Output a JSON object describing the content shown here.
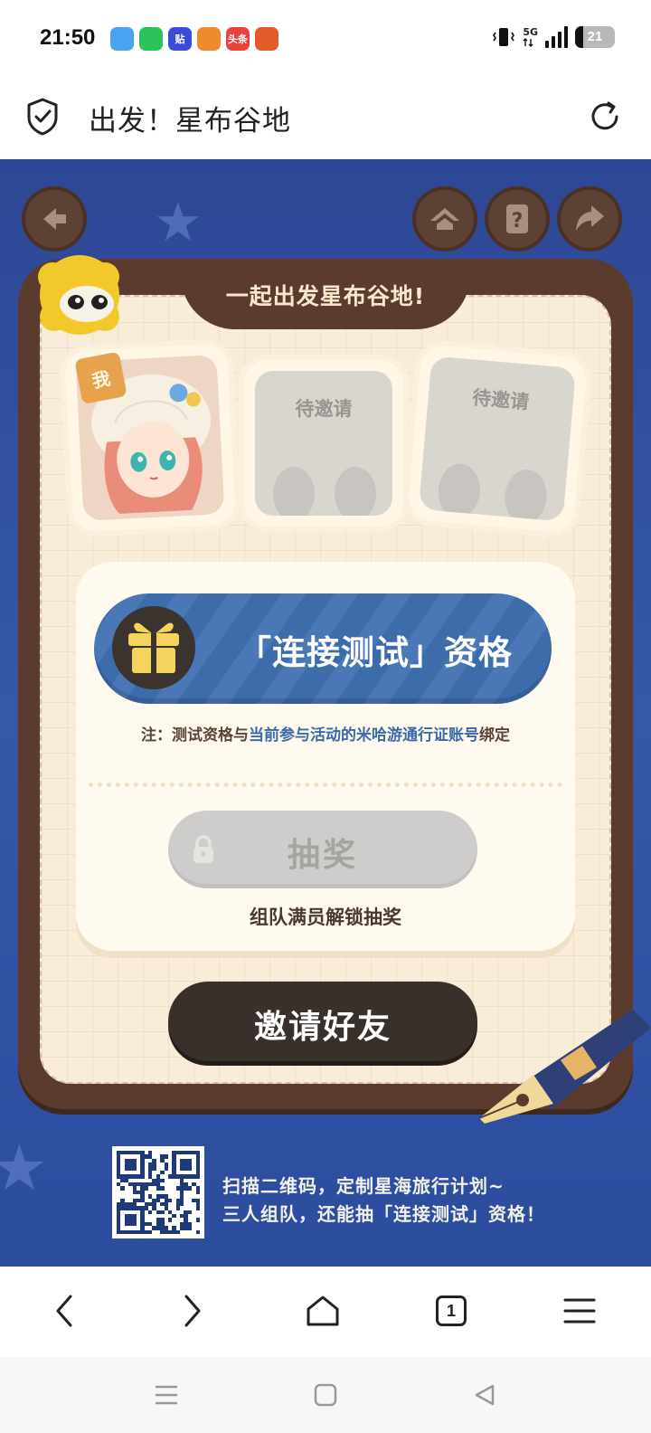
{
  "status_bar": {
    "time": "21:50",
    "network": "5G",
    "battery": "21",
    "battery_level": 0.21,
    "notification_icons": [
      {
        "name": "weather-app-icon",
        "color": "#4aa3f0",
        "text": ""
      },
      {
        "name": "wechat-app-icon",
        "color": "#2bc25a",
        "text": ""
      },
      {
        "name": "tieba-app-icon",
        "color": "#3b4bd6",
        "text": "贴"
      },
      {
        "name": "video-app-icon",
        "color": "#f08a2e",
        "text": ""
      },
      {
        "name": "toutiao-app-icon",
        "color": "#e8423a",
        "text": "头条"
      },
      {
        "name": "game-app-icon",
        "color": "#e35b2a",
        "text": ""
      }
    ]
  },
  "browser": {
    "page_title": "出发！星布谷地",
    "tab_count": "1"
  },
  "game": {
    "banner_title": "一起出发星布谷地!",
    "me_badge": "我",
    "pending_slots": [
      "待邀请",
      "待邀请"
    ],
    "qualification_label": "「连接测试」资格",
    "note_prefix": "注：测试资格与",
    "note_highlight": "当前参与活动的米哈游通行证账号",
    "note_suffix": "绑定",
    "draw_label": "抽奖",
    "draw_locked": true,
    "unlock_note": "组队满员解锁抽奖",
    "invite_label": "邀请好友",
    "promo_line1": "扫描二维码，定制星海旅行计划~",
    "promo_line2": "三人组队，还能抽「连接测试」资格！"
  },
  "colors": {
    "background_blue": "#3558a8",
    "frame_brown": "#5a3b2d",
    "paper": "#f9ecd8",
    "qualification_blue": "#3d6cab",
    "highlight_blue": "#3a6aa8",
    "invite_button": "#3a302b"
  }
}
